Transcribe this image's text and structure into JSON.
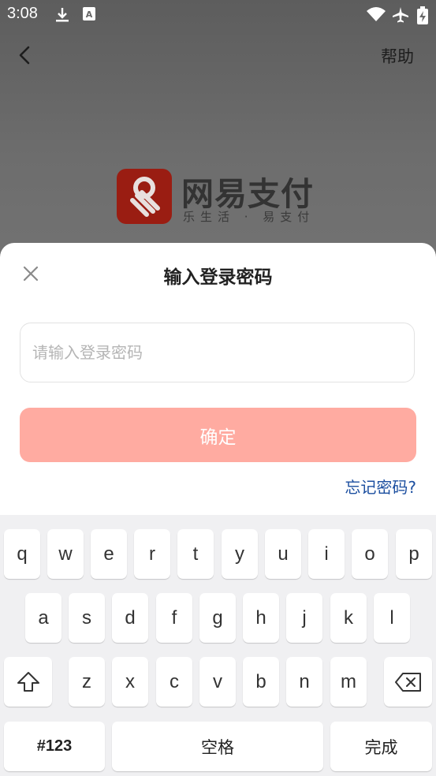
{
  "status_bar": {
    "time": "3:08",
    "icons": [
      "download-icon",
      "notification-a-icon",
      "wifi-icon",
      "airplane-icon",
      "battery-charging-icon"
    ]
  },
  "header": {
    "back_icon": "chevron-left-icon",
    "help_label": "帮助"
  },
  "logo": {
    "title": "网易支付",
    "slogan": "乐生活 · 易支付",
    "badge_color": "#9a1d12"
  },
  "dialog": {
    "close_icon": "close-icon",
    "title": "输入登录密码",
    "password_value": "",
    "password_placeholder": "请输入登录密码",
    "confirm_label": "确定",
    "forgot_label": "忘记密码?",
    "accent_color": "#ffaba1",
    "link_color": "#1c4fa0"
  },
  "keyboard": {
    "row1": [
      "q",
      "w",
      "e",
      "r",
      "t",
      "y",
      "u",
      "i",
      "o",
      "p"
    ],
    "row2": [
      "a",
      "s",
      "d",
      "f",
      "g",
      "h",
      "j",
      "k",
      "l"
    ],
    "row3": [
      "z",
      "x",
      "c",
      "v",
      "b",
      "n",
      "m"
    ],
    "shift_icon": "shift-icon",
    "backspace_icon": "backspace-icon",
    "symbols_label": "#123",
    "space_label": "空格",
    "done_label": "完成"
  }
}
